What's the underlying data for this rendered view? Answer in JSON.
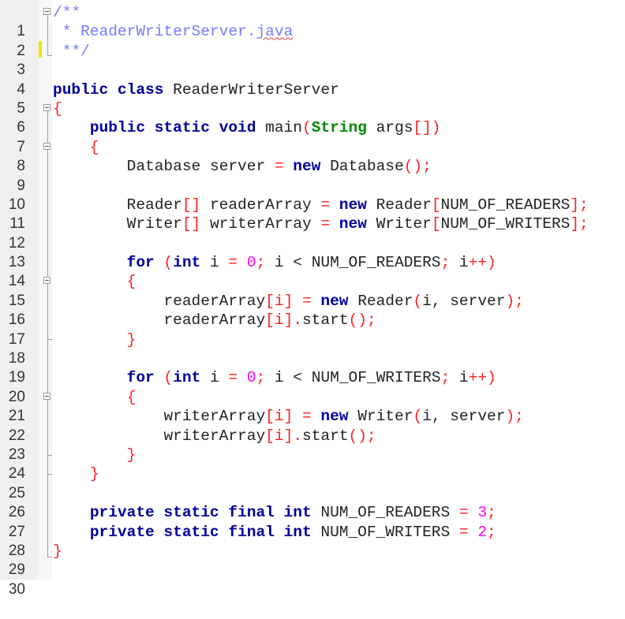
{
  "editor": {
    "language": "java",
    "file_name": "ReaderWriterServer.java",
    "line_numbers": [
      "1",
      "2",
      "3",
      "4",
      "5",
      "6",
      "7",
      "8",
      "9",
      "10",
      "11",
      "12",
      "13",
      "14",
      "15",
      "16",
      "17",
      "18",
      "19",
      "20",
      "21",
      "22",
      "23",
      "24",
      "25",
      "26",
      "27",
      "28",
      "29",
      "30"
    ],
    "colors": {
      "keyword": "#00009c",
      "type": "#008800",
      "operator": "#ff2020",
      "number": "#ff00ff",
      "comment": "#7878ff",
      "text": "#222222",
      "change_marker": "#f0e000"
    },
    "code": {
      "l1": "/**",
      "l2_prefix": " * ReaderWriterServer.",
      "l2_word": "java",
      "l3": " **/",
      "l5_kw": "public class",
      "l5_name": " ReaderWriterServer",
      "brace_open": "{",
      "brace_close": "}",
      "l7_kw": "public static void",
      "l7_main": " main",
      "l7_paren": "(",
      "l7_type": "String",
      "l7_args": " args",
      "l7_end": "[])",
      "l9_a": "Database server ",
      "eq": "=",
      "new": "new",
      "l9_b": " Database",
      "call_end": "();",
      "l11_a": "Reader",
      "brackets": "[]",
      "l11_b": " readerArray ",
      "l11_c": " Reader",
      "lbr": "[",
      "l11_d": "NUM_OF_READERS",
      "rbr_semi": "];",
      "l12_a": "Writer",
      "l12_b": " writerArray ",
      "l12_c": " Writer",
      "l12_d": "NUM_OF_WRITERS",
      "for": "for",
      "for_paren": " (",
      "int": "int",
      "for_i": " i ",
      "zero": "0",
      "semi": ";",
      "for_lt": " i < ",
      "for_readers": "NUM_OF_READERS",
      "for_inc_i": " i",
      "inc_close": "++)",
      "for_writers": "NUM_OF_WRITERS",
      "l16_a": "readerArray",
      "idx": "[i]",
      "l16_b": " Reader",
      "paren_open": "(",
      "args_is": "i, server",
      "paren_semi": ");",
      "dot": ".",
      "start": "start",
      "l22_a": "writerArray",
      "l22_b": " Writer",
      "l27_kw": "private static final int",
      "l27_name": " NUM_OF_READERS ",
      "three": "3",
      "l28_name": " NUM_OF_WRITERS ",
      "two": "2"
    }
  }
}
